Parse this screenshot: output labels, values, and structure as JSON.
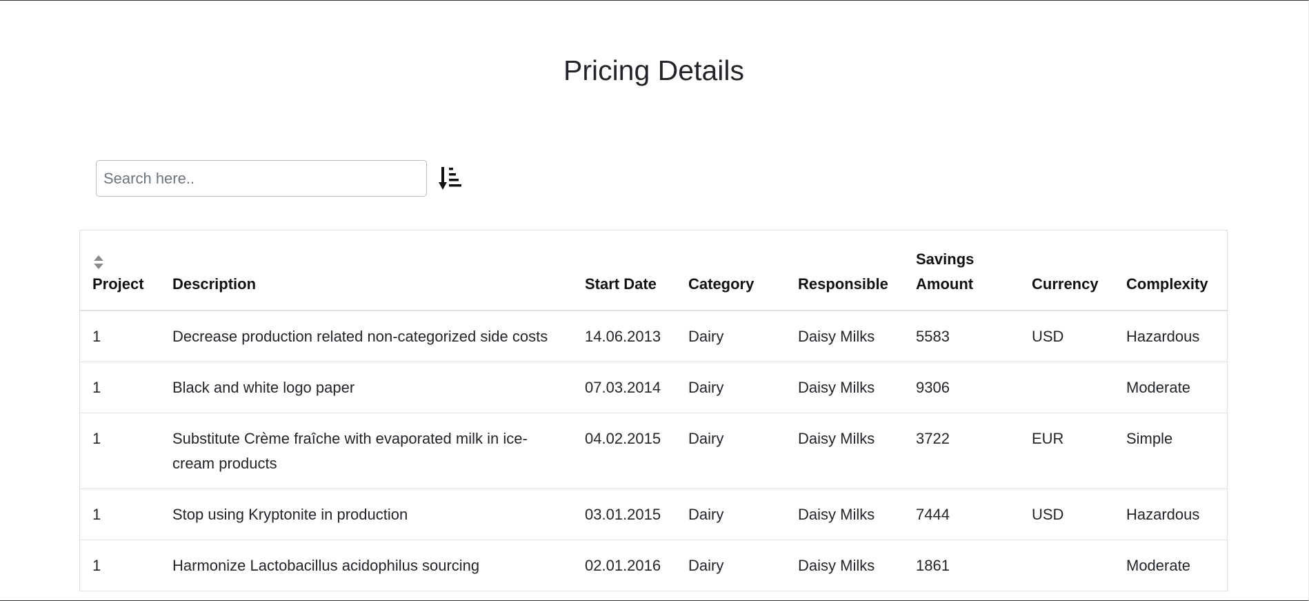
{
  "page": {
    "title": "Pricing Details"
  },
  "search": {
    "placeholder": "Search here..",
    "value": "",
    "sort_icon": "sort-amount-down-icon"
  },
  "table": {
    "columns": {
      "project": "Project",
      "description": "Description",
      "start_date": "Start Date",
      "category": "Category",
      "responsible": "Responsible",
      "savings_amount": "Savings Amount",
      "currency": "Currency",
      "complexity": "Complexity"
    },
    "sort_icon": "sort-caret-icon",
    "rows": [
      {
        "project": "1",
        "description": "Decrease production related non-categorized side costs",
        "start_date": "14.06.2013",
        "category": "Dairy",
        "responsible": "Daisy Milks",
        "savings_amount": "5583",
        "currency": "USD",
        "complexity": "Hazardous"
      },
      {
        "project": "1",
        "description": "Black and white logo paper",
        "start_date": "07.03.2014",
        "category": "Dairy",
        "responsible": "Daisy Milks",
        "savings_amount": "9306",
        "currency": "",
        "complexity": "Moderate"
      },
      {
        "project": "1",
        "description": "Substitute Crème fraîche with evaporated milk in ice-cream products",
        "start_date": "04.02.2015",
        "category": "Dairy",
        "responsible": "Daisy Milks",
        "savings_amount": "3722",
        "currency": "EUR",
        "complexity": "Simple"
      },
      {
        "project": "1",
        "description": "Stop using Kryptonite in production",
        "start_date": "03.01.2015",
        "category": "Dairy",
        "responsible": "Daisy Milks",
        "savings_amount": "7444",
        "currency": "USD",
        "complexity": "Hazardous"
      },
      {
        "project": "1",
        "description": "Harmonize Lactobacillus acidophilus sourcing",
        "start_date": "02.01.2016",
        "category": "Dairy",
        "responsible": "Daisy Milks",
        "savings_amount": "1861",
        "currency": "",
        "complexity": "Moderate"
      }
    ]
  }
}
